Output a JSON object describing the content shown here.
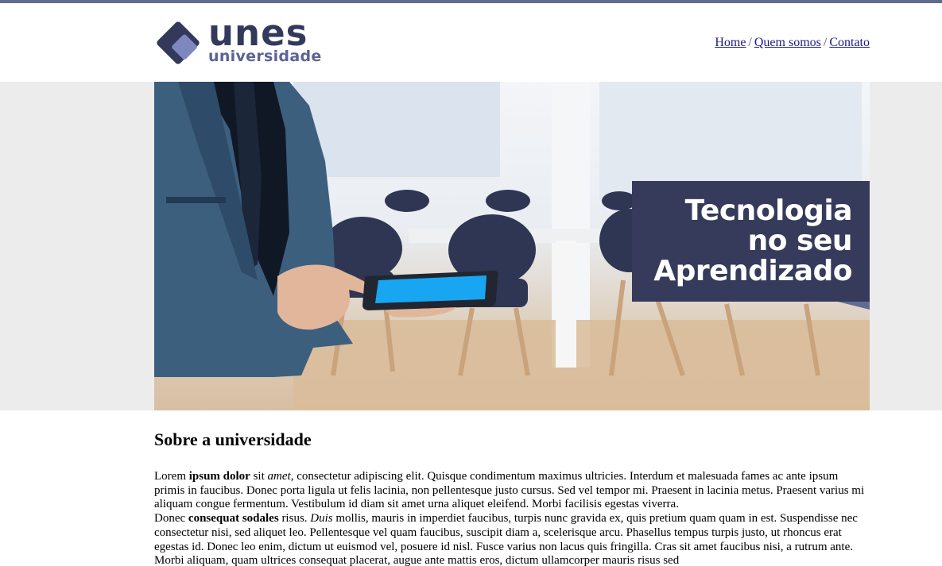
{
  "colors": {
    "accent_stripe": "#616b92",
    "brand_dark": "#33395a",
    "brand_light": "#5b6396",
    "tagline_bg": "#363b5b",
    "link": "#1a1a8c"
  },
  "logo": {
    "word": "unes",
    "sub": "universidade"
  },
  "nav": {
    "links": [
      "Home",
      "Quem somos",
      "Contato"
    ],
    "separator": "/"
  },
  "banner": {
    "tagline": [
      "Tecnologia",
      "no seu",
      "Aprendizado"
    ]
  },
  "about": {
    "heading": "Sobre a universidade",
    "p1_a": "Lorem ",
    "p1_b": "ipsum dolor",
    "p1_c": " sit ",
    "p1_d": "amet",
    "p1_e": ", consectetur adipiscing elit. Quisque condimentum maximus ultricies. Interdum et malesuada fames ac ante ipsum primis in faucibus. Donec porta ligula ut felis lacinia, non pellentesque justo cursus. Sed vel tempor mi. Praesent in lacinia metus. Praesent varius mi aliquam congue fermentum. Vestibulum id diam sit amet urna aliquet eleifend. Morbi facilisis egestas viverra.",
    "p2_a": "Donec ",
    "p2_b": "consequat sodales",
    "p2_c": " risus. ",
    "p2_d": "Duis",
    "p2_e": " mollis, mauris in imperdiet faucibus, turpis nunc gravida ex, quis pretium quam quam in est. Suspendisse nec consectetur nisi, sed aliquet leo. Pellentesque vel quam faucibus, suscipit diam a, scelerisque arcu. Phasellus tempus turpis justo, ut rhoncus erat egestas id. Donec leo enim, dictum ut euismod vel, posuere id nisl. Fusce varius non lacus quis fringilla. Cras sit amet faucibus nisi, a rutrum ante. Morbi aliquam, quam ultrices consequat placerat, augue ante mattis eros, dictum ullamcorper mauris risus sed"
  }
}
